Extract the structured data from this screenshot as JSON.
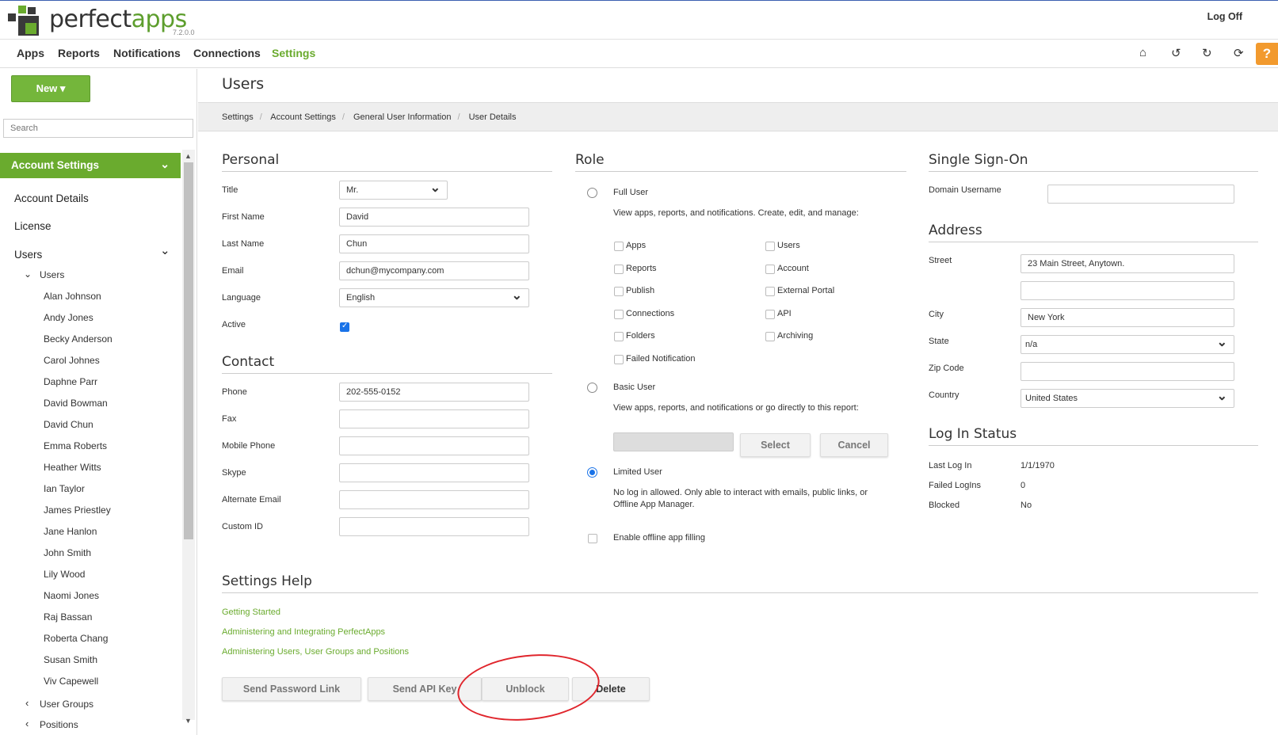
{
  "header": {
    "brand_prefix": "perfect",
    "brand_suffix": "apps",
    "version": "7.2.0.0",
    "logoff": "Log Off",
    "help": "?"
  },
  "nav": {
    "items": [
      "Apps",
      "Reports",
      "Notifications",
      "Connections",
      "Settings"
    ],
    "active": "Settings",
    "icons": [
      "home-icon",
      "undo-icon",
      "refresh-icon",
      "sync-icon"
    ]
  },
  "sidebar": {
    "new_label": "New ▾",
    "search_placeholder": "Search",
    "section": "Account Settings",
    "items": [
      "Account Details",
      "License",
      "Users"
    ],
    "users_group": "Users",
    "users": [
      "Alan Johnson",
      "Andy Jones",
      "Becky Anderson",
      "Carol Johnes",
      "Daphne Parr",
      "David Bowman",
      "David Chun",
      "Emma Roberts",
      "Heather Witts",
      "Ian Taylor",
      "James Priestley",
      "Jane Hanlon",
      "John Smith",
      "Lily Wood",
      "Naomi Jones",
      "Raj Bassan",
      "Roberta Chang",
      "Susan Smith",
      "Viv Capewell"
    ],
    "user_groups": "User Groups",
    "positions": "Positions"
  },
  "page": {
    "title": "Users",
    "breadcrumb": [
      "Settings",
      "Account Settings",
      "General User Information",
      "User Details"
    ]
  },
  "personal": {
    "title": "Personal",
    "labels": {
      "title": "Title",
      "first": "First Name",
      "last": "Last Name",
      "email": "Email",
      "language": "Language",
      "active": "Active"
    },
    "values": {
      "title": "Mr.",
      "first": "David",
      "last": "Chun",
      "email": "dchun@mycompany.com",
      "language": "English",
      "active": true
    }
  },
  "contact": {
    "title": "Contact",
    "labels": {
      "phone": "Phone",
      "fax": "Fax",
      "mobile": "Mobile Phone",
      "skype": "Skype",
      "alt_email": "Alternate Email",
      "custom_id": "Custom ID"
    },
    "values": {
      "phone": "202-555-0152",
      "fax": "",
      "mobile": "",
      "skype": "",
      "alt_email": "",
      "custom_id": ""
    }
  },
  "role": {
    "title": "Role",
    "full_user": "Full User",
    "full_desc": "View apps, reports, and notifications. Create, edit, and manage:",
    "perms_left": [
      "Apps",
      "Reports",
      "Publish",
      "Connections",
      "Folders",
      "Failed Notification"
    ],
    "perms_right": [
      "Users",
      "Account",
      "External Portal",
      "API",
      "Archiving"
    ],
    "basic_user": "Basic User",
    "basic_desc": "View apps, reports, and notifications or go directly to this report:",
    "select_label": "Select",
    "cancel_label": "Cancel",
    "limited_user": "Limited User",
    "limited_desc_1": "No log in allowed. Only able to interact with emails, public links, or",
    "limited_desc_2": "Offline App Manager.",
    "offline_label": "Enable offline app filling",
    "selected": "Limited User"
  },
  "sso": {
    "title": "Single Sign-On",
    "domain_label": "Domain Username",
    "domain_value": ""
  },
  "address": {
    "title": "Address",
    "labels": {
      "street": "Street",
      "city": "City",
      "state": "State",
      "zip": "Zip Code",
      "country": "Country"
    },
    "values": {
      "street1": "23 Main Street, Anytown.",
      "street2": "",
      "city": "New York",
      "state": "n/a",
      "zip": "",
      "country": "United States"
    }
  },
  "login_status": {
    "title": "Log In Status",
    "labels": {
      "last": "Last Log In",
      "failed": "Failed LogIns",
      "blocked": "Blocked"
    },
    "values": {
      "last": "1/1/1970",
      "failed": "0",
      "blocked": "No"
    }
  },
  "help": {
    "title": "Settings Help",
    "links": [
      "Getting Started",
      "Administering and Integrating PerfectApps",
      "Administering Users, User Groups and Positions"
    ]
  },
  "actions": {
    "send_password": "Send Password Link",
    "send_api": "Send API Key",
    "unblock": "Unblock",
    "delete": "Delete"
  },
  "colors": {
    "accent": "#6aab2e",
    "help_button": "#f29a2e",
    "annotation": "#e0252c"
  }
}
